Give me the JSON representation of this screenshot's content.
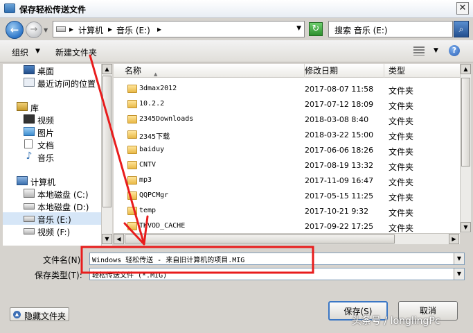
{
  "window": {
    "title": "保存轻松传送文件",
    "close_glyph": "✕"
  },
  "address": {
    "crumbs": [
      "计算机",
      "音乐 (E:)"
    ],
    "separator": "▸",
    "search_text": "搜索 音乐 (E:)"
  },
  "toolbar": {
    "organize": "组织",
    "new_folder": "新建文件夹"
  },
  "nav": {
    "items": [
      {
        "label": "桌面",
        "icon": "desktop-icon"
      },
      {
        "label": "最近访问的位置",
        "icon": "recent-places-icon"
      },
      {
        "label": "库",
        "icon": "library-icon"
      },
      {
        "label": "视频",
        "icon": "video-library-icon"
      },
      {
        "label": "图片",
        "icon": "pictures-library-icon"
      },
      {
        "label": "文档",
        "icon": "documents-library-icon"
      },
      {
        "label": "音乐",
        "icon": "music-library-icon"
      },
      {
        "label": "计算机",
        "icon": "computer-icon"
      },
      {
        "label": "本地磁盘 (C:)",
        "icon": "local-disk-c-icon"
      },
      {
        "label": "本地磁盘 (D:)",
        "icon": "local-disk-d-icon"
      },
      {
        "label": "音乐 (E:)",
        "icon": "drive-e-icon"
      },
      {
        "label": "视频 (F:)",
        "icon": "drive-f-icon"
      }
    ],
    "selected_index": 10
  },
  "files": {
    "columns": {
      "name": "名称",
      "date": "修改日期",
      "type": "类型"
    },
    "rows": [
      {
        "name": "3dmax2012",
        "date": "2017-08-07 11:58",
        "type": "文件夹"
      },
      {
        "name": "10.2.2",
        "date": "2017-07-12 18:09",
        "type": "文件夹"
      },
      {
        "name": "2345Downloads",
        "date": "2018-03-08 8:40",
        "type": "文件夹"
      },
      {
        "name": "2345下载",
        "date": "2018-03-22 15:00",
        "type": "文件夹"
      },
      {
        "name": "baiduy",
        "date": "2017-06-06 18:26",
        "type": "文件夹"
      },
      {
        "name": "CNTV",
        "date": "2017-08-19 13:32",
        "type": "文件夹"
      },
      {
        "name": "mp3",
        "date": "2017-11-09 16:47",
        "type": "文件夹"
      },
      {
        "name": "QQPCMgr",
        "date": "2017-05-15 11:25",
        "type": "文件夹"
      },
      {
        "name": "temp",
        "date": "2017-10-21 9:32",
        "type": "文件夹"
      },
      {
        "name": "TKVOD_CACHE",
        "date": "2017-09-22 17:25",
        "type": "文件夹"
      }
    ]
  },
  "form": {
    "filename_label": "文件名(N):",
    "filename_value": "Windows 轻松传送 - 来自旧计算机的项目.MIG",
    "savetype_label": "保存类型(T):",
    "savetype_value": "轻松传送文件 (*.MIG)"
  },
  "buttons": {
    "hide_folders": "隐藏文件夹",
    "save": "保存(S)",
    "cancel": "取消"
  },
  "watermark": "头条号 / longlingPc",
  "colors": {
    "annotation_red": "#e81c1c",
    "selection": "#d6e6f7",
    "accent_blue": "#3a76c4"
  }
}
